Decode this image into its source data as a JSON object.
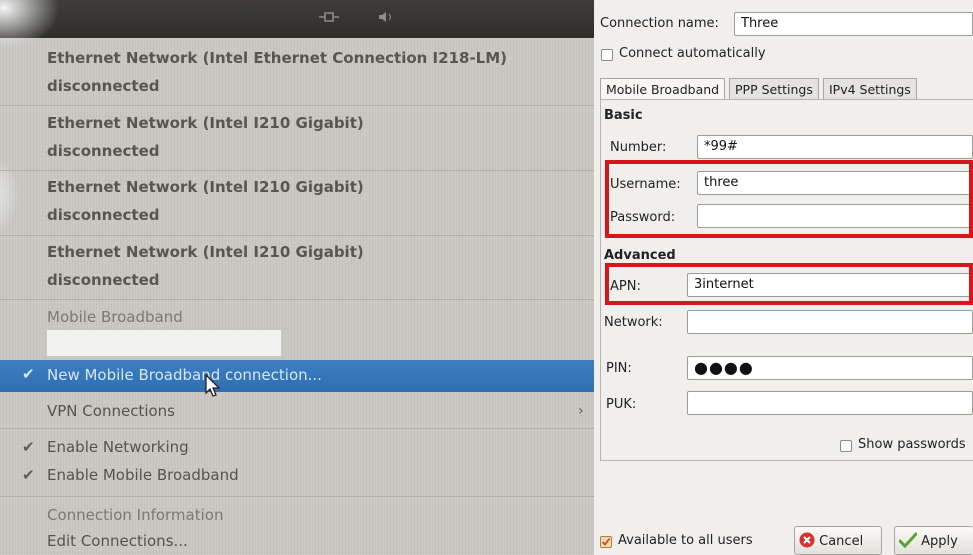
{
  "menu": {
    "items": [
      {
        "title": "Ethernet Network (Intel Ethernet Connection I218-LM)",
        "status": "disconnected"
      },
      {
        "title": "Ethernet Network (Intel I210 Gigabit)",
        "status": "disconnected"
      },
      {
        "title": "Ethernet Network (Intel I210 Gigabit)",
        "status": "disconnected"
      },
      {
        "title": "Ethernet Network (Intel I210 Gigabit)",
        "status": "disconnected"
      }
    ],
    "mobile_broadband": "Mobile Broadband",
    "new_connection": "New Mobile Broadband connection...",
    "vpn": "VPN Connections",
    "enable_networking": "Enable Networking",
    "enable_mobile": "Enable Mobile Broadband",
    "connection_info": "Connection Information",
    "edit_connections": "Edit Connections..."
  },
  "editor": {
    "connection_name_label": "Connection name:",
    "connection_name_value": "Three",
    "connect_automatically": "Connect automatically",
    "tabs": [
      "Mobile Broadband",
      "PPP Settings",
      "IPv4 Settings"
    ],
    "basic_heading": "Basic",
    "number_label": "Number:",
    "number_value": "*99#",
    "username_label": "Username:",
    "username_value": "three",
    "password_label": "Password:",
    "password_value": "",
    "advanced_heading": "Advanced",
    "apn_label": "APN:",
    "apn_value": "3internet",
    "network_label": "Network:",
    "network_value": "",
    "pin_label": "PIN:",
    "pin_value": "●●●●",
    "puk_label": "PUK:",
    "puk_value": "",
    "show_passwords": "Show passwords",
    "available_to_all": "Available to all users",
    "cancel": "Cancel",
    "apply": "Apply"
  },
  "colors": {
    "highlight": "#3478bd",
    "annotation_red": "#d7161c"
  }
}
